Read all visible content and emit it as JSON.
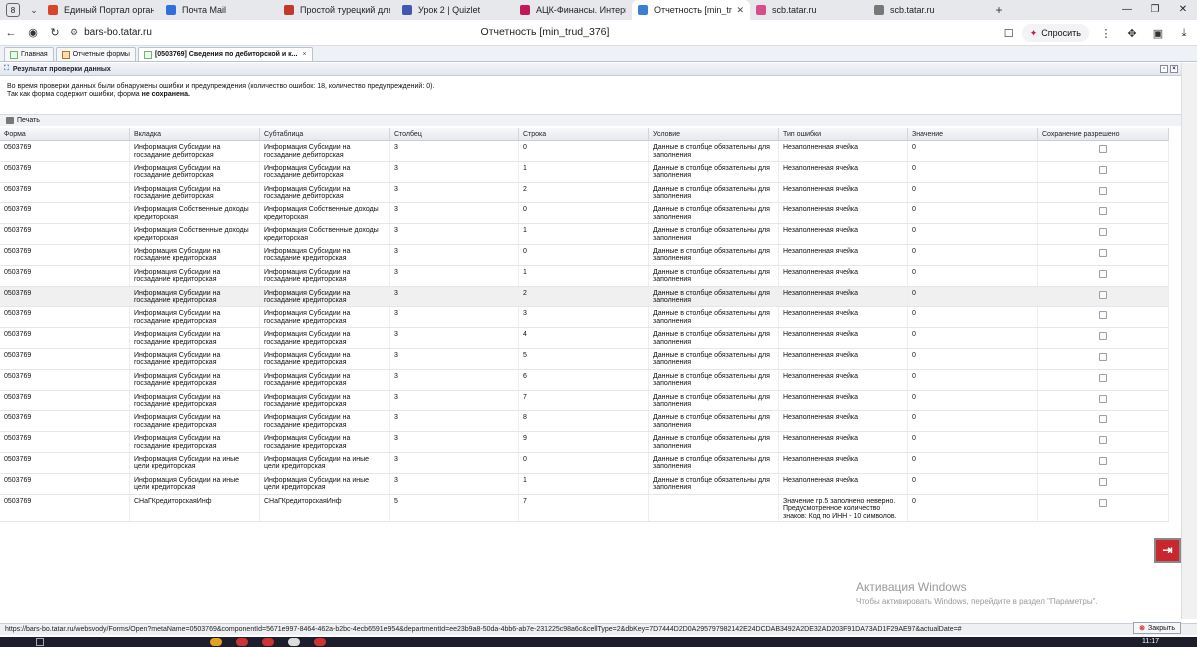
{
  "browser": {
    "tab_count": "8",
    "tabs": [
      {
        "label": "Единый Портал органов",
        "color": "#d8452a",
        "active": false
      },
      {
        "label": "Почта Mail",
        "color": "#2f6fe0",
        "active": false
      },
      {
        "label": "Простой турецкий для",
        "color": "#c0392b",
        "active": false
      },
      {
        "label": "Урок 2 | Quizlet",
        "color": "#4257b2",
        "active": false
      },
      {
        "label": "АЦК-Финансы. Интерн",
        "color": "#c2185b",
        "active": false
      },
      {
        "label": "Отчетность [min_trud",
        "color": "#3b7fd0",
        "active": true
      },
      {
        "label": "scb.tatar.ru",
        "color": "#d94c8a",
        "active": false
      },
      {
        "label": "scb.tatar.ru",
        "color": "#777777",
        "active": false
      }
    ],
    "url": "bars-bo.tatar.ru",
    "page_title": "Отчетность [min_trud_376]",
    "ask_label": "Спросить"
  },
  "app_tabs": [
    {
      "label": "Главная",
      "active": false
    },
    {
      "label": "Отчетные формы",
      "active": false
    },
    {
      "label": "[0503769] Сведения по дебиторской и к...",
      "active": true
    }
  ],
  "panel": {
    "title": "Результат проверки данных",
    "message_line1": "Во время проверки данных были обнаружены ошибки и предупреждения (количество ошибок: 18, количество предупреждений: 0).",
    "message_line2_prefix": "Так как форма содержит ошибки, форма ",
    "message_line2_bold": "не сохранена.",
    "print_label": "Печать"
  },
  "grid": {
    "columns": [
      "Форма",
      "Вкладка",
      "Субтаблица",
      "Столбец",
      "Строка",
      "Условие",
      "Тип ошибки",
      "Значение",
      "Сохранение разрешено"
    ],
    "rows": [
      {
        "form": "0503769",
        "tab": "Информация Субсидии на госзадание дебиторская",
        "subtable": "Информация Субсидии на госзадание дебиторская",
        "column": "3",
        "row": "0",
        "condition": "Данные в столбце обязательны для заполнения",
        "error_type": "Незаполненная ячейка",
        "value": "0"
      },
      {
        "form": "0503769",
        "tab": "Информация Субсидии на госзадание дебиторская",
        "subtable": "Информация Субсидии на госзадание дебиторская",
        "column": "3",
        "row": "1",
        "condition": "Данные в столбце обязательны для заполнения",
        "error_type": "Незаполненная ячейка",
        "value": "0"
      },
      {
        "form": "0503769",
        "tab": "Информация Субсидии на госзадание дебиторская",
        "subtable": "Информация Субсидии на госзадание дебиторская",
        "column": "3",
        "row": "2",
        "condition": "Данные в столбце обязательны для заполнения",
        "error_type": "Незаполненная ячейка",
        "value": "0"
      },
      {
        "form": "0503769",
        "tab": "Информация Собственные доходы кредиторская",
        "subtable": "Информация Собственные доходы кредиторская",
        "column": "3",
        "row": "0",
        "condition": "Данные в столбце обязательны для заполнения",
        "error_type": "Незаполненная ячейка",
        "value": "0"
      },
      {
        "form": "0503769",
        "tab": "Информация Собственные доходы кредиторская",
        "subtable": "Информация Собственные доходы кредиторская",
        "column": "3",
        "row": "1",
        "condition": "Данные в столбце обязательны для заполнения",
        "error_type": "Незаполненная ячейка",
        "value": "0"
      },
      {
        "form": "0503769",
        "tab": "Информация Субсидии на госзадание кредиторская",
        "subtable": "Информация Субсидии на госзадание кредиторская",
        "column": "3",
        "row": "0",
        "condition": "Данные в столбце обязательны для заполнения",
        "error_type": "Незаполненная ячейка",
        "value": "0"
      },
      {
        "form": "0503769",
        "tab": "Информация Субсидии на госзадание кредиторская",
        "subtable": "Информация Субсидии на госзадание кредиторская",
        "column": "3",
        "row": "1",
        "condition": "Данные в столбце обязательны для заполнения",
        "error_type": "Незаполненная ячейка",
        "value": "0"
      },
      {
        "form": "0503769",
        "tab": "Информация Субсидии на госзадание кредиторская",
        "subtable": "Информация Субсидии на госзадание кредиторская",
        "column": "3",
        "row": "2",
        "condition": "Данные в столбце обязательны для заполнения",
        "error_type": "Незаполненная ячейка",
        "value": "0",
        "highlight": true
      },
      {
        "form": "0503769",
        "tab": "Информация Субсидии на госзадание кредиторская",
        "subtable": "Информация Субсидии на госзадание кредиторская",
        "column": "3",
        "row": "3",
        "condition": "Данные в столбце обязательны для заполнения",
        "error_type": "Незаполненная ячейка",
        "value": "0"
      },
      {
        "form": "0503769",
        "tab": "Информация Субсидии на госзадание кредиторская",
        "subtable": "Информация Субсидии на госзадание кредиторская",
        "column": "3",
        "row": "4",
        "condition": "Данные в столбце обязательны для заполнения",
        "error_type": "Незаполненная ячейка",
        "value": "0"
      },
      {
        "form": "0503769",
        "tab": "Информация Субсидии на госзадание кредиторская",
        "subtable": "Информация Субсидии на госзадание кредиторская",
        "column": "3",
        "row": "5",
        "condition": "Данные в столбце обязательны для заполнения",
        "error_type": "Незаполненная ячейка",
        "value": "0"
      },
      {
        "form": "0503769",
        "tab": "Информация Субсидии на госзадание кредиторская",
        "subtable": "Информация Субсидии на госзадание кредиторская",
        "column": "3",
        "row": "6",
        "condition": "Данные в столбце обязательны для заполнения",
        "error_type": "Незаполненная ячейка",
        "value": "0"
      },
      {
        "form": "0503769",
        "tab": "Информация Субсидии на госзадание кредиторская",
        "subtable": "Информация Субсидии на госзадание кредиторская",
        "column": "3",
        "row": "7",
        "condition": "Данные в столбце обязательны для заполнения",
        "error_type": "Незаполненная ячейка",
        "value": "0"
      },
      {
        "form": "0503769",
        "tab": "Информация Субсидии на госзадание кредиторская",
        "subtable": "Информация Субсидии на госзадание кредиторская",
        "column": "3",
        "row": "8",
        "condition": "Данные в столбце обязательны для заполнения",
        "error_type": "Незаполненная ячейка",
        "value": "0"
      },
      {
        "form": "0503769",
        "tab": "Информация Субсидии на госзадание кредиторская",
        "subtable": "Информация Субсидии на госзадание кредиторская",
        "column": "3",
        "row": "9",
        "condition": "Данные в столбце обязательны для заполнения",
        "error_type": "Незаполненная ячейка",
        "value": "0"
      },
      {
        "form": "0503769",
        "tab": "Информация Субсидии на иные цели кредиторская",
        "subtable": "Информация Субсидии на иные цели кредиторская",
        "column": "3",
        "row": "0",
        "condition": "Данные в столбце обязательны для заполнения",
        "error_type": "Незаполненная ячейка",
        "value": "0"
      },
      {
        "form": "0503769",
        "tab": "Информация Субсидии на иные цели кредиторская",
        "subtable": "Информация Субсидии на иные цели кредиторская",
        "column": "3",
        "row": "1",
        "condition": "Данные в столбце обязательны для заполнения",
        "error_type": "Незаполненная ячейка",
        "value": "0"
      },
      {
        "form": "0503769",
        "tab": "СНаГКредиторскаяИнф",
        "subtable": "СНаГКредиторскаяИнф",
        "column": "5",
        "row": "7",
        "condition": "",
        "error_type": "Значение гр.5 заполнено неверно. Предусмотренное количество знаков: Код по ИНН - 10 символов.",
        "value": "0",
        "tall": true
      }
    ]
  },
  "watermark": {
    "title": "Активация Windows",
    "subtitle": "Чтобы активировать Windows, перейдите в раздел \"Параметры\"."
  },
  "status_url": "https://bars-bo.tatar.ru/websvody/Forms/Open?metaName=0503769&componentId=5671e997-8464-462a-b2bc-4ecb6591e954&departmentId=ee23b9a8-50da-4bb6-ab7e-231225c98a6c&cellType=2&dbKey=7D7444D2D0A295797982142E24DCDAB3492A2DE32AD203F91DA73AD1F29AE97&actualDate=#",
  "close_label": "Закрыть",
  "clock": "11:17"
}
